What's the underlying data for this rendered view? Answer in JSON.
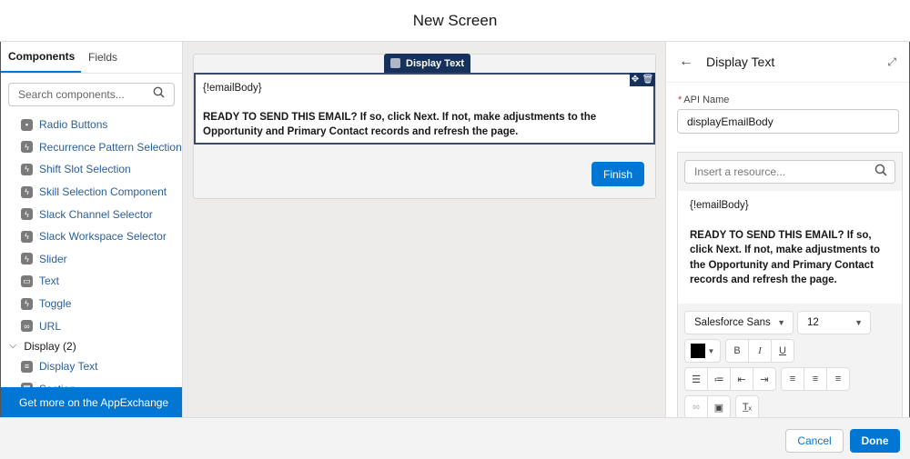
{
  "header": {
    "title": "New Screen"
  },
  "left_panel": {
    "tabs": [
      {
        "label": "Components",
        "active": true
      },
      {
        "label": "Fields",
        "active": false
      }
    ],
    "search_placeholder": "Search components...",
    "components": [
      {
        "label": "Radio Buttons",
        "icon": "radio-buttons-icon"
      },
      {
        "label": "Recurrence Pattern Selection",
        "icon": "lightning-icon"
      },
      {
        "label": "Shift Slot Selection",
        "icon": "lightning-icon"
      },
      {
        "label": "Skill Selection Component",
        "icon": "lightning-icon"
      },
      {
        "label": "Slack Channel Selector",
        "icon": "lightning-icon"
      },
      {
        "label": "Slack Workspace Selector",
        "icon": "lightning-icon"
      },
      {
        "label": "Slider",
        "icon": "lightning-icon"
      },
      {
        "label": "Text",
        "icon": "text-field-icon"
      },
      {
        "label": "Toggle",
        "icon": "lightning-icon"
      },
      {
        "label": "URL",
        "icon": "link-icon"
      }
    ],
    "display_section": {
      "label": "Display (2)",
      "items": [
        {
          "label": "Display Text",
          "icon": "display-text-icon"
        },
        {
          "label": "Section",
          "icon": "section-icon"
        }
      ]
    },
    "appexchange_label": "Get more on the AppExchange"
  },
  "canvas": {
    "component_tag": "Display Text",
    "variable": "{!emailBody}",
    "message": "READY TO SEND THIS EMAIL? If so, click Next. If not, make adjustments to the Opportunity and Primary Contact records and refresh the page.",
    "finish_label": "Finish"
  },
  "right_panel": {
    "title": "Display Text",
    "api_name_label": "API Name",
    "api_name_value": "displayEmailBody",
    "resource_placeholder": "Insert a resource...",
    "editor_variable": "{!emailBody}",
    "editor_message": "READY TO SEND THIS EMAIL? If so, click Next. If not, make adjustments to the Opportunity and Primary Contact records and refresh the page.",
    "font_family": "Salesforce Sans",
    "font_size": "12",
    "text_color": "#000000"
  },
  "footer": {
    "cancel_label": "Cancel",
    "done_label": "Done"
  },
  "colors": {
    "brand_blue": "#0176d3",
    "selected_navy": "#16325c"
  }
}
